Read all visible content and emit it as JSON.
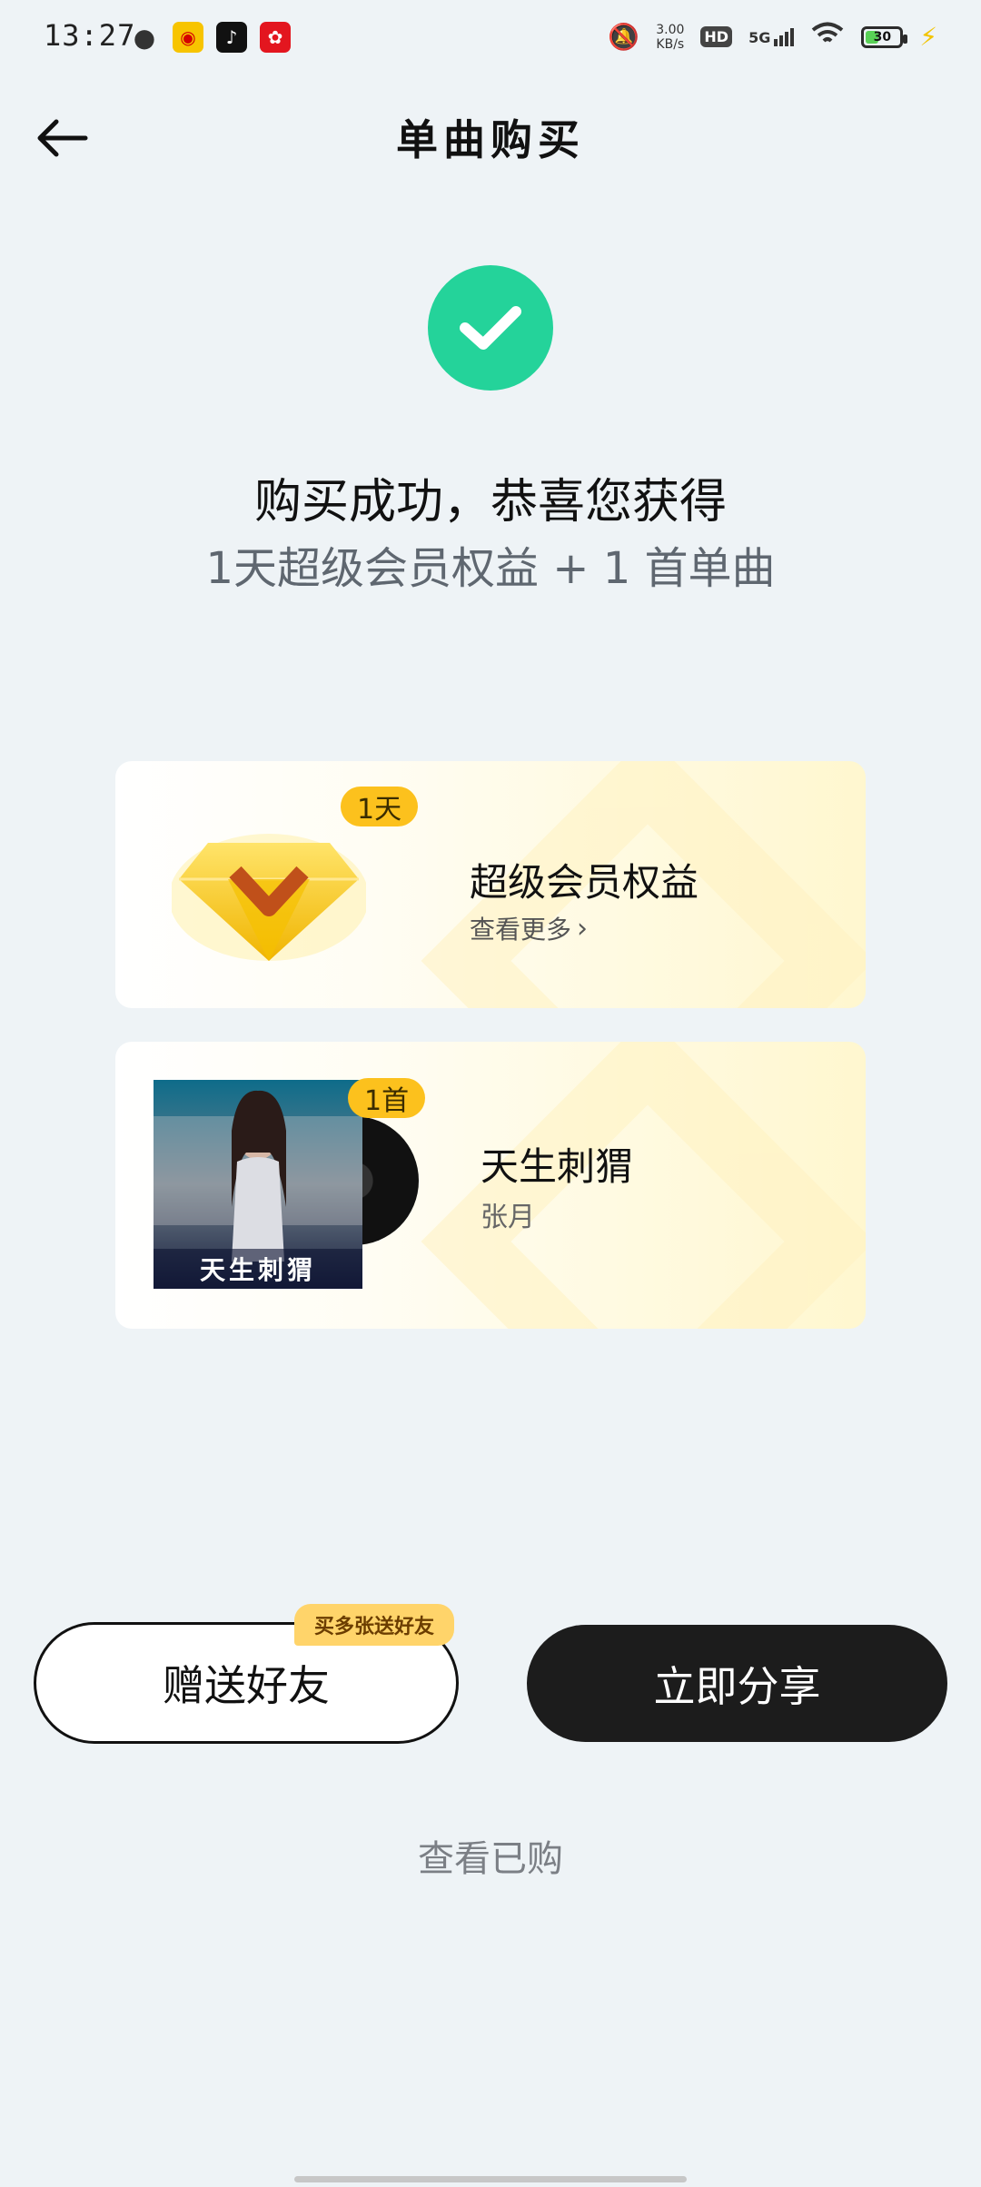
{
  "status_bar": {
    "time": "13:27",
    "net_speed_value": "3.00",
    "net_speed_unit": "KB/s",
    "hd": "HD",
    "network": "5G",
    "battery": "30"
  },
  "header": {
    "title": "单曲购买"
  },
  "success": {
    "title": "购买成功，恭喜您获得",
    "subtitle": "1天超级会员权益 + 1 首单曲"
  },
  "cards": [
    {
      "badge": "1天",
      "title": "超级会员权益",
      "link": "查看更多"
    },
    {
      "badge": "1首",
      "title": "天生刺猬",
      "artist": "张月",
      "album_text": "天生刺猬"
    }
  ],
  "actions": {
    "gift_label": "赠送好友",
    "gift_tag": "买多张送好友",
    "share_label": "立即分享",
    "purchased_label": "查看已购"
  },
  "colors": {
    "accent_success": "#24d39a",
    "badge": "#fcc11d",
    "share_button": "#1c1c1c"
  }
}
